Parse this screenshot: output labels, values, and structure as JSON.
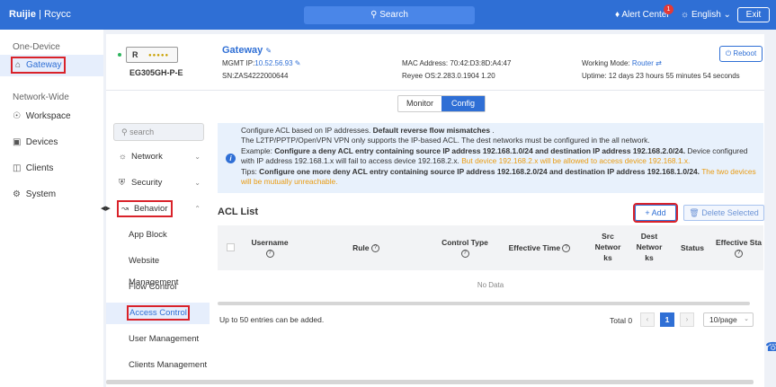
{
  "topbar": {
    "logo_brand": "Ruijie",
    "logo_product": "Rcycc",
    "search_label": "Search",
    "alert_label": "Alert Center",
    "alert_count": "1",
    "language": "English",
    "exit_label": "Exit"
  },
  "leftnav": {
    "section1": "One-Device",
    "gateway": "Gateway",
    "section2": "Network-Wide",
    "items": [
      {
        "label": "Workspace"
      },
      {
        "label": "Devices"
      },
      {
        "label": "Clients"
      },
      {
        "label": "System"
      }
    ]
  },
  "device": {
    "model": "EG305GH-P-E",
    "name": "Gateway",
    "mgmt_ip_label": "MGMT IP:",
    "mgmt_ip": "10.52.56.93",
    "sn_label": "SN:",
    "sn": "ZAS4222000644",
    "mac_label": "MAC Address:",
    "mac": "70:42:D3:8D:A4:47",
    "os_label": "Reyee OS:",
    "os": "2.283.0.1904 1.20",
    "mode_label": "Working Mode:",
    "mode": "Router",
    "uptime_label": "Uptime:",
    "uptime": "12 days 23 hours 55 minutes 54 seconds",
    "reboot_label": "Reboot"
  },
  "tabs": {
    "monitor": "Monitor",
    "config": "Config"
  },
  "subnav": {
    "search_placeholder": "search",
    "network": "Network",
    "security": "Security",
    "behavior": "Behavior",
    "leaves": [
      {
        "label": "App Block"
      },
      {
        "label": "Website Management"
      },
      {
        "label": "Flow Control"
      },
      {
        "label": "Access Control"
      },
      {
        "label": "User Management"
      },
      {
        "label": "Clients Management"
      }
    ]
  },
  "notice": {
    "line1_a": "Configure ACL based on IP addresses.",
    "line1_b": "Default reverse flow mismatches",
    "line1_c": ".",
    "line2": "The L2TP/PPTP/OpenVPN VPN only supports the IP-based ACL. The dest networks must be configured in the all network.",
    "line3_a": "Example:",
    "line3_b": "Configure a deny ACL entry containing source IP address 192.168.1.0/24 and destination IP address 192.168.2.0/24.",
    "line3_c": "Device configured with IP address 192.168.1.x will fail to access device 192.168.2.x.",
    "line3_d": "But device 192.168.2.x will be allowed to access device 192.168.1.x.",
    "line4_a": "Tips:",
    "line4_b": "Configure one more deny ACL entry containing source IP address 192.168.2.0/24 and destination IP address 192.168.1.0/24.",
    "line4_c": "The two devices will be mutually unreachable."
  },
  "acl": {
    "title": "ACL List",
    "add_label": "Add",
    "delete_label": "Delete Selected",
    "columns": {
      "username": "Username",
      "rule": "Rule",
      "control_type": "Control Type",
      "effective_time": "Effective Time",
      "src_1": "Src",
      "src_2": "Networ",
      "src_3": "ks",
      "dest_1": "Dest",
      "dest_2": "Networ",
      "dest_3": "ks",
      "status": "Status",
      "effective_status": "Effective Sta"
    },
    "no_data": "No Data",
    "footer_text": "Up to 50 entries can be added.",
    "total": "Total 0",
    "page": "1",
    "page_size": "10/page"
  }
}
